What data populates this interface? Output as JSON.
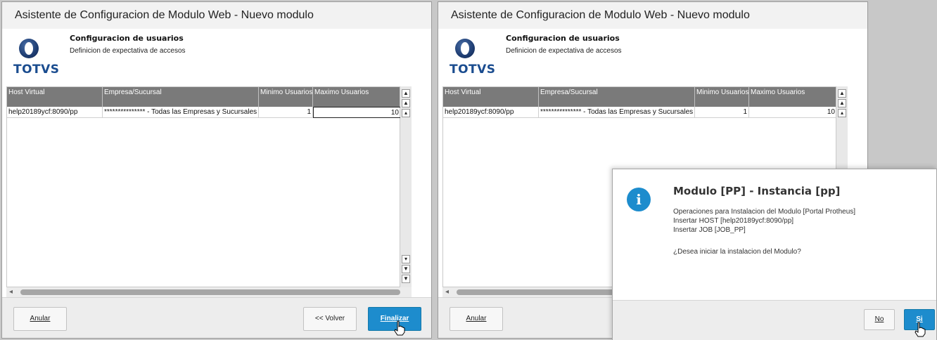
{
  "window_title": "Asistente de Configuracion de Modulo Web - Nuevo modulo",
  "brand": "TOTVS",
  "section": {
    "title": "Configuracion de usuarios",
    "subtitle": "Definicion de expectativa de accesos"
  },
  "table": {
    "columns": [
      "Host Virtual",
      "Empresa/Sucursal",
      "Minimo Usuarios",
      "Maximo Usuarios"
    ],
    "rows": [
      [
        "help20189ycf:8090/pp",
        "*************** - Todas las Empresas y Sucursales",
        "1",
        "10"
      ]
    ]
  },
  "buttons": {
    "anular": "Anular",
    "volver": "<< Volver",
    "finalizar": "Finalizar"
  },
  "dialog": {
    "title": "Modulo [PP] - Instancia [pp]",
    "lines": [
      "Operaciones para Instalacion del Modulo [Portal Protheus]",
      "Insertar HOST [help20189ycf:8090/pp]",
      "Insertar JOB [JOB_PP]"
    ],
    "question": "¿Desea iniciar la instalacion del Modulo?",
    "no_label": "No",
    "si_label": "Si"
  },
  "colors": {
    "primary": "#1d8ccd",
    "header": "#7a7a7a",
    "brand": "#1a4c8f"
  },
  "icons": [
    "totvs-logo",
    "info-icon",
    "hand-cursor-icon"
  ]
}
